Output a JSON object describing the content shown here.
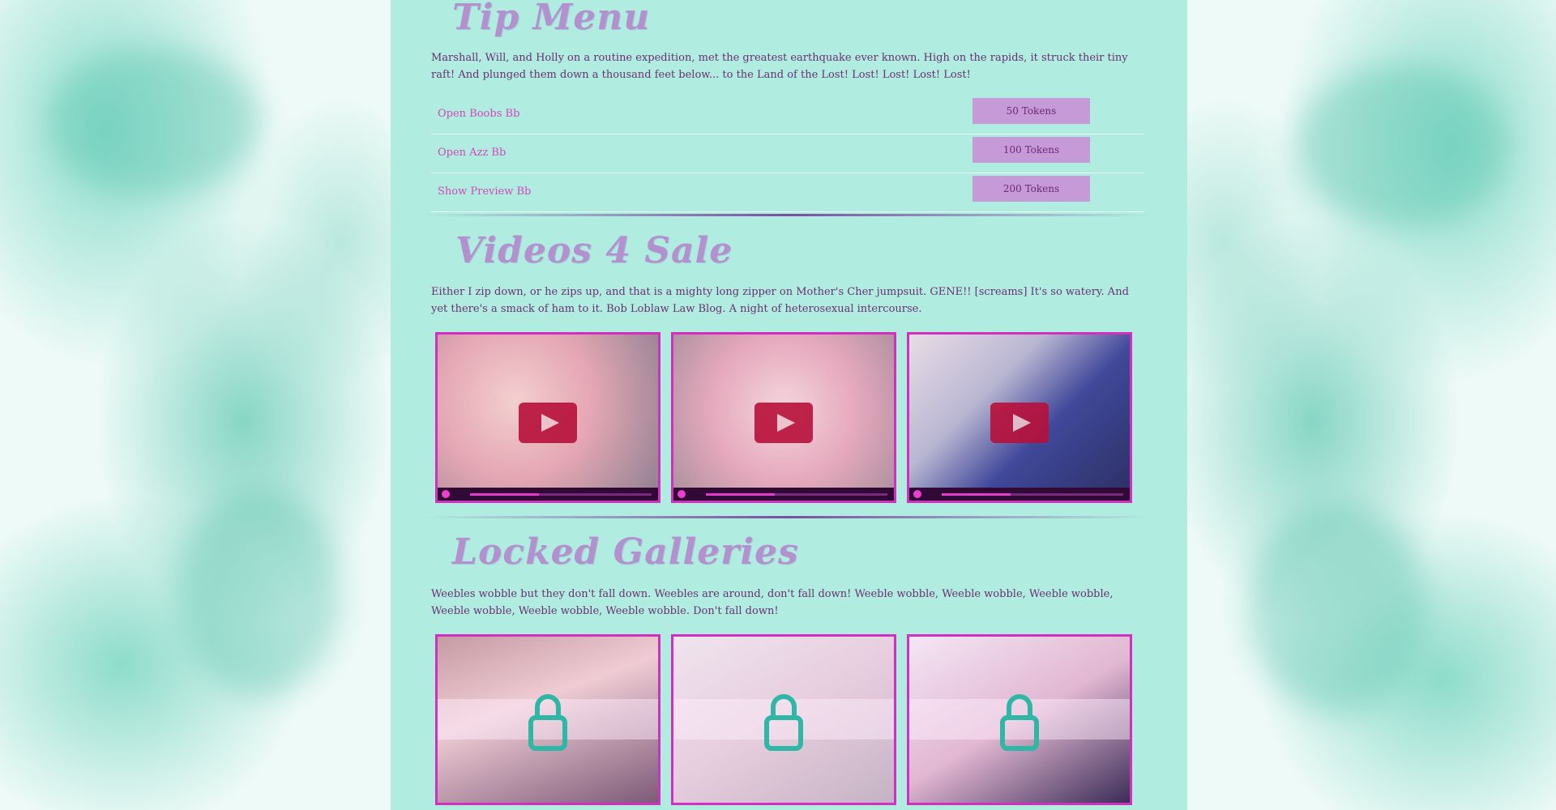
{
  "tip_menu": {
    "title": "Tip Menu",
    "description": "Marshall, Will, and Holly on a routine expedition, met the greatest earthquake ever known. High on the rapids, it struck their tiny raft! And plunged them down a thousand feet below... to the Land of the Lost! Lost! Lost! Lost! Lost!",
    "items": [
      {
        "label": "Open Boobs Bb",
        "price": "50 Tokens"
      },
      {
        "label": "Open Azz Bb",
        "price": "100 Tokens"
      },
      {
        "label": "Show Preview Bb",
        "price": "200 Tokens"
      }
    ]
  },
  "videos": {
    "title": "Videos 4 Sale",
    "description": "Either I zip down, or he zips up, and that is a mighty long zipper on Mother's Cher jumpsuit. GENE!! [screams] It's so watery. And yet there's a smack of ham to it. Bob Loblaw Law Blog. A night of heterosexual intercourse.",
    "items": [
      {
        "progress": 0.38
      },
      {
        "progress": 0.38
      },
      {
        "progress": 0.38
      }
    ]
  },
  "galleries": {
    "title": "Locked Galleries",
    "description": "Weebles wobble but they don't fall down. Weebles are around, don't fall down! Weeble wobble, Weeble wobble, Weeble wobble, Weeble wobble, Weeble wobble, Weeble wobble. Don't fall down!",
    "item_count": 3
  },
  "colors": {
    "panel": "#b0ede0",
    "accent": "#d22fc0",
    "price_bg": "#c59ad6",
    "title": "#b391cf",
    "text": "#6b2f74"
  }
}
